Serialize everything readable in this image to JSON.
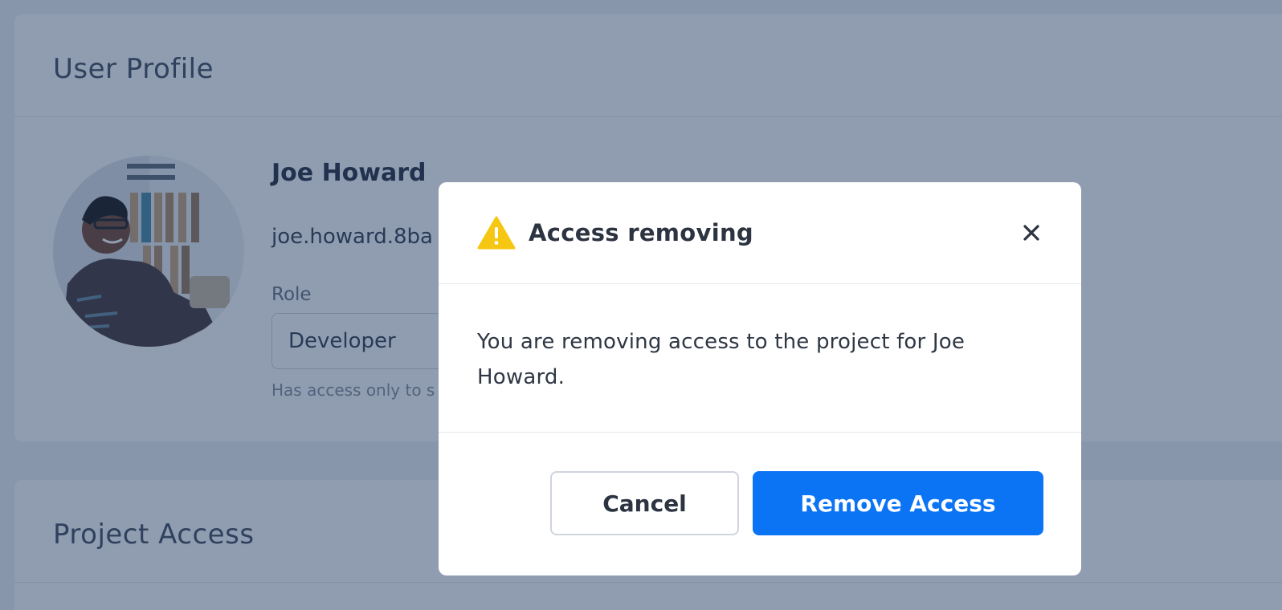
{
  "profile_card": {
    "title": "User Profile",
    "name": "Joe Howard",
    "email": "joe.howard.8ba",
    "role_label": "Role",
    "role_value": "Developer",
    "role_hint": "Has access only to s"
  },
  "project_card": {
    "title": "Project Access"
  },
  "modal": {
    "title": "Access removing",
    "message": "You are removing access to the project for Joe Howard.",
    "cancel_label": "Cancel",
    "confirm_label": "Remove Access",
    "icons": {
      "warning": "warning-triangle-icon",
      "close": "close-icon"
    }
  },
  "colors": {
    "primary": "#0b74f5",
    "warning": "#f6c712",
    "overlay": "#18325c"
  }
}
